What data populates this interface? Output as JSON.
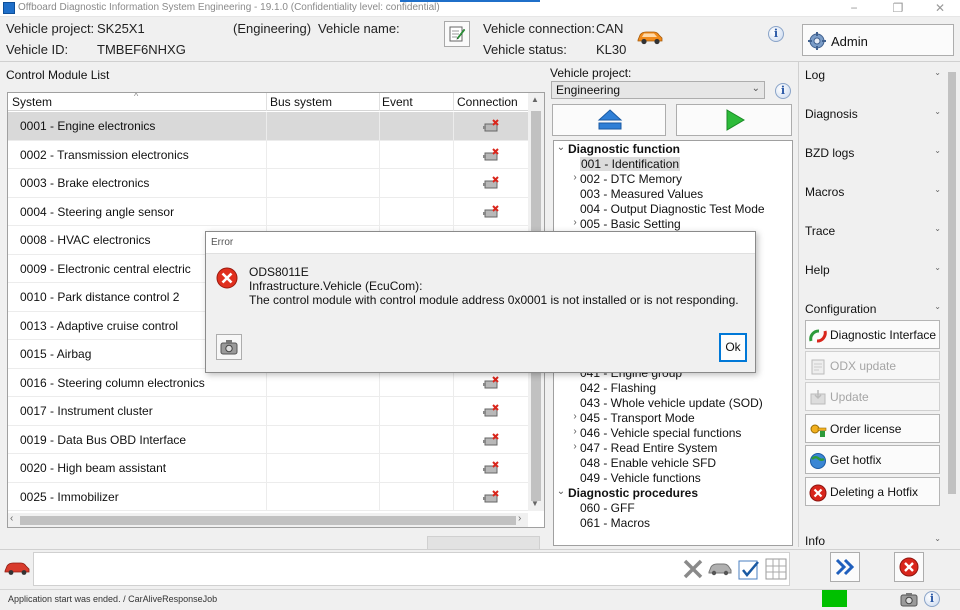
{
  "window": {
    "title": "Offboard Diagnostic Information System Engineering - 19.1.0 (Confidentiality level: confidential)",
    "minimize_glyph": "−",
    "maximize_glyph": "❐",
    "close_glyph": "✕"
  },
  "header": {
    "vehicle_project_label": "Vehicle project:",
    "vehicle_project_value": "SK25X1",
    "mode_value": "(Engineering)",
    "vehicle_name_label": "Vehicle name:",
    "vehicle_id_label": "Vehicle ID:",
    "vehicle_id_value": "TMBEF6NHXG",
    "vehicle_connection_label": "Vehicle connection:",
    "vehicle_connection_value": "CAN",
    "vehicle_status_label": "Vehicle status:",
    "vehicle_status_value": "KL30",
    "info_glyph": "i"
  },
  "admin": {
    "label": "Admin"
  },
  "control_module_list": {
    "title": "Control Module List",
    "sort_glyph": "^",
    "columns": [
      "System",
      "Bus system",
      "Event",
      "Connection"
    ],
    "rows": [
      {
        "name": "0001 - Engine electronics",
        "selected": true
      },
      {
        "name": "0002 - Transmission electronics"
      },
      {
        "name": "0003 - Brake electronics"
      },
      {
        "name": "0004 - Steering angle sensor"
      },
      {
        "name": "0008 - HVAC electronics"
      },
      {
        "name": "0009 - Electronic central electric"
      },
      {
        "name": "0010 - Park distance control 2"
      },
      {
        "name": "0013 - Adaptive cruise control"
      },
      {
        "name": "0015 - Airbag"
      },
      {
        "name": "0016 - Steering column electronics"
      },
      {
        "name": "0017 - Instrument cluster"
      },
      {
        "name": "0019 - Data Bus OBD Interface"
      },
      {
        "name": "0020 - High beam assistant"
      },
      {
        "name": "0025 - Immobilizer"
      }
    ],
    "scroll_left_glyph": "‹",
    "scroll_right_glyph": "›",
    "scroll_up_glyph": "▲",
    "scroll_down_glyph": "▼"
  },
  "project_panel": {
    "label": "Vehicle project:",
    "selected": "Engineering",
    "chevron_glyph": "⌄",
    "info_glyph": "i"
  },
  "tree": {
    "expanded_glyph": "⌄",
    "collapsed_glyph": "›",
    "items": [
      {
        "label": "Diagnostic function",
        "level": 0,
        "expander": "expanded"
      },
      {
        "label": "001 - Identification",
        "level": 1,
        "expander": "none",
        "selected": true
      },
      {
        "label": "002 - DTC Memory",
        "level": 1,
        "expander": "collapsed"
      },
      {
        "label": "003 - Measured Values",
        "level": 1,
        "expander": "none"
      },
      {
        "label": "004 - Output Diagnostic Test Mode",
        "level": 1,
        "expander": "none"
      },
      {
        "label": "005 - Basic Setting",
        "level": 1,
        "expander": "collapsed"
      },
      {
        "label": "041 - Engine group",
        "level": 1,
        "expander": "none"
      },
      {
        "label": "042 - Flashing",
        "level": 1,
        "expander": "none"
      },
      {
        "label": "043 - Whole vehicle update (SOD)",
        "level": 1,
        "expander": "none"
      },
      {
        "label": "045 - Transport Mode",
        "level": 1,
        "expander": "collapsed"
      },
      {
        "label": "046 - Vehicle special functions",
        "level": 1,
        "expander": "collapsed"
      },
      {
        "label": "047 - Read Entire System",
        "level": 1,
        "expander": "collapsed"
      },
      {
        "label": "048 - Enable vehicle SFD",
        "level": 1,
        "expander": "none"
      },
      {
        "label": "049 - Vehicle functions",
        "level": 1,
        "expander": "none"
      },
      {
        "label": "Diagnostic procedures",
        "level": 0,
        "expander": "expanded"
      },
      {
        "label": "060 - GFF",
        "level": 1,
        "expander": "none"
      },
      {
        "label": "061 - Macros",
        "level": 1,
        "expander": "none"
      }
    ]
  },
  "right_panel": {
    "caret_glyph": "⌄",
    "sections": [
      "Log",
      "Diagnosis",
      "BZD logs",
      "Macros",
      "Trace",
      "Help",
      "Configuration",
      "Info"
    ],
    "configuration_buttons": [
      {
        "label": "Diagnostic Interface",
        "enabled": true
      },
      {
        "label": "ODX update",
        "enabled": false
      },
      {
        "label": "Update",
        "enabled": false
      },
      {
        "label": "Order license",
        "enabled": true
      },
      {
        "label": "Get hotfix",
        "enabled": true
      },
      {
        "label": "Deleting a Hotfix",
        "enabled": true
      }
    ]
  },
  "status_bar": {
    "message": "Application start was ended. / CarAliveResponseJob",
    "info_glyph": "i"
  },
  "error_dialog": {
    "title": "Error",
    "code": "ODS8011E",
    "source": "Infrastructure.Vehicle (EcuCom):",
    "message": "The control module with control module address 0x0001 is not installed or is not responding.",
    "ok_label": "Ok"
  },
  "colors": {
    "accent_blue": "#0078d7",
    "error_red": "#d9261c",
    "status_green": "#00c000",
    "selection_gray": "#d9d9d9"
  }
}
